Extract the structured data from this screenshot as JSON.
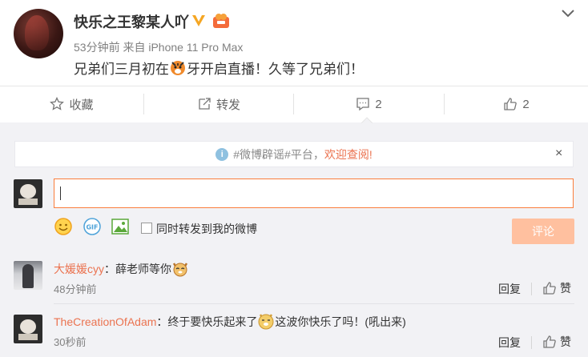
{
  "post": {
    "username": "快乐之王黎某人吖",
    "time": "53分钟前",
    "source_prefix": "来自",
    "source": "iPhone 11 Pro Max",
    "text_before": "兄弟们三月初在",
    "text_after": "牙开启直播！久等了兄弟们！"
  },
  "actions": {
    "collect": "收藏",
    "forward": "转发",
    "comment_count": "2",
    "like_count": "2"
  },
  "notice": {
    "prefix": "#微博辟谣#平台，",
    "link": "欢迎查阅!",
    "close": "×"
  },
  "composer": {
    "input_value": "",
    "forward_label": "同时转发到我的微博",
    "submit_label": "评论"
  },
  "comments": [
    {
      "name": "大媛媛cyy",
      "text": "：薛老师等你",
      "time": "48分钟前",
      "reply": "回复",
      "like": "赞"
    },
    {
      "name": "TheCreationOfAdam",
      "text_before": "：终于要快乐起来了",
      "text_after": "这波你快乐了吗！(吼出来)",
      "time": "30秒前",
      "reply": "回复",
      "like": "赞"
    }
  ],
  "colors": {
    "accent": "#eb7350",
    "input_border": "#fa7d3c",
    "submit_disabled": "#ffc09f",
    "vip": "#ffa500"
  }
}
